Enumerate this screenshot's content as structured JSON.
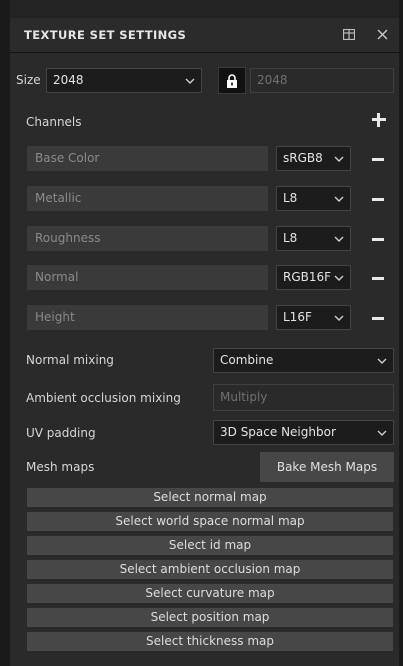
{
  "panel": {
    "title": "TEXTURE SET SETTINGS",
    "icons": [
      "window-toggle-icon",
      "close-icon"
    ]
  },
  "size": {
    "label": "Size",
    "value": "2048",
    "linked_value": "2048",
    "lock_icon": "lock-icon"
  },
  "channels": {
    "label": "Channels",
    "add_icon": "plus-icon",
    "items": [
      {
        "name": "Base Color",
        "format": "sRGB8"
      },
      {
        "name": "Metallic",
        "format": "L8"
      },
      {
        "name": "Roughness",
        "format": "L8"
      },
      {
        "name": "Normal",
        "format": "RGB16F"
      },
      {
        "name": "Height",
        "format": "L16F"
      }
    ]
  },
  "normal_mixing": {
    "label": "Normal mixing",
    "value": "Combine"
  },
  "ao_mixing": {
    "label": "Ambient occlusion mixing",
    "value": "Multiply"
  },
  "uv_padding": {
    "label": "UV padding",
    "value": "3D Space Neighbor"
  },
  "mesh_maps": {
    "label": "Mesh maps",
    "bake_label": "Bake Mesh Maps",
    "buttons": [
      "Select normal map",
      "Select world space normal map",
      "Select id map",
      "Select ambient occlusion map",
      "Select curvature map",
      "Select position map",
      "Select thickness map"
    ]
  }
}
